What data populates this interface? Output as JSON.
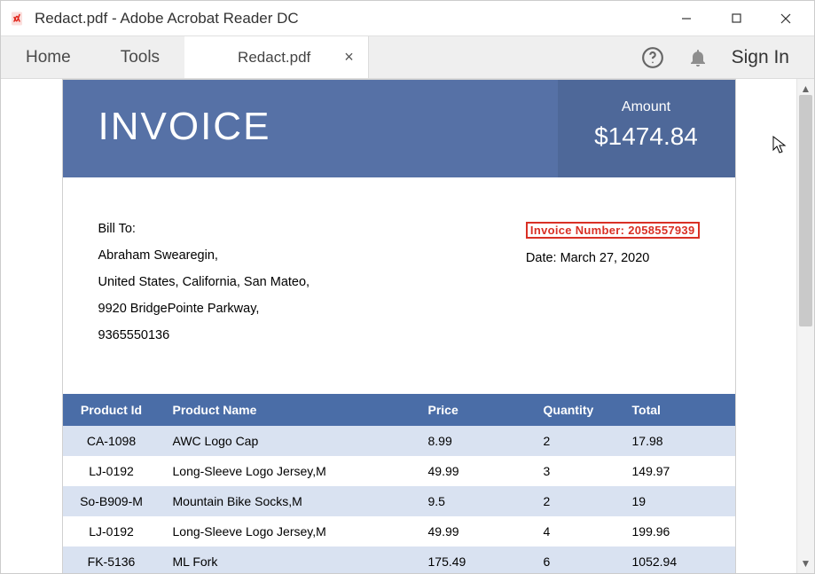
{
  "window": {
    "title": "Redact.pdf - Adobe Acrobat Reader DC"
  },
  "toolbar": {
    "home": "Home",
    "tools": "Tools",
    "tab_title": "Redact.pdf",
    "sign_in": "Sign In"
  },
  "invoice": {
    "title": "INVOICE",
    "amount_label": "Amount",
    "amount_value": "$1474.84",
    "bill_to_label": "Bill To:",
    "bill_to_name": "Abraham Swearegin,",
    "bill_to_region": "United States, California, San Mateo,",
    "bill_to_street": "9920 BridgePointe Parkway,",
    "bill_to_phone": "9365550136",
    "invoice_number": "Invoice Number: 2058557939",
    "date": "Date: March 27, 2020",
    "columns": {
      "c0": "Product Id",
      "c1": "Product Name",
      "c2": "Price",
      "c3": "Quantity",
      "c4": "Total"
    },
    "rows": [
      {
        "id": "CA-1098",
        "name": "AWC Logo Cap",
        "price": "8.99",
        "qty": "2",
        "total": "17.98"
      },
      {
        "id": "LJ-0192",
        "name": "Long-Sleeve Logo Jersey,M",
        "price": "49.99",
        "qty": "3",
        "total": "149.97"
      },
      {
        "id": "So-B909-M",
        "name": "Mountain Bike Socks,M",
        "price": "9.5",
        "qty": "2",
        "total": "19"
      },
      {
        "id": "LJ-0192",
        "name": "Long-Sleeve Logo Jersey,M",
        "price": "49.99",
        "qty": "4",
        "total": "199.96"
      },
      {
        "id": "FK-5136",
        "name": "ML Fork",
        "price": "175.49",
        "qty": "6",
        "total": "1052.94"
      }
    ]
  }
}
